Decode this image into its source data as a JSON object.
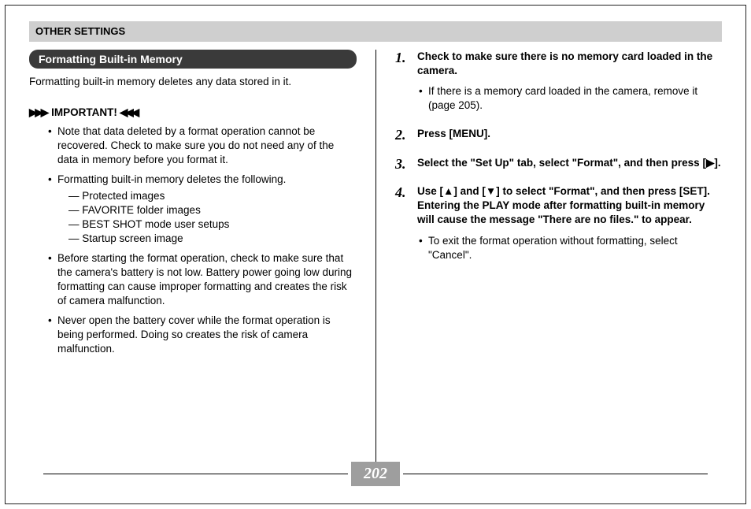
{
  "header": {
    "title": "OTHER SETTINGS"
  },
  "section": {
    "heading": "Formatting Built-in Memory",
    "intro": "Formatting built-in memory deletes any data stored in it.",
    "important_label": "IMPORTANT!",
    "arrows_left": "▶▶▶",
    "arrows_right": "▶▶▶",
    "bullets": {
      "b0": "Note that data deleted by a format operation cannot be recovered. Check to make sure you do not need any of the data in memory before you format it.",
      "b1": "Formatting built-in memory deletes the following.",
      "b1_items": {
        "d0": "Protected images",
        "d1": "FAVORITE folder images",
        "d2": "BEST SHOT mode user setups",
        "d3": "Startup screen image"
      },
      "b2": "Before starting the format operation, check to make sure that the camera's battery is not low. Battery power going low during formatting can cause improper formatting and creates the risk of camera malfunction.",
      "b3": "Never open the battery cover while the format operation is being performed. Doing so creates the risk of camera malfunction."
    }
  },
  "steps": {
    "s1_num": "1.",
    "s1": "Check to make sure there is no memory card loaded in the camera.",
    "s1_sub": "If there is a memory card loaded in the camera, remove it (page 205).",
    "s2_num": "2.",
    "s2": "Press [MENU].",
    "s3_num": "3.",
    "s3": "Select the \"Set Up\" tab, select \"Format\", and then press [▶].",
    "s4_num": "4.",
    "s4": "Use [▲] and [▼] to select \"Format\", and then press [SET]. Entering the PLAY mode after formatting built-in memory will cause the message \"There are no files.\" to appear.",
    "s4_sub": "To exit the format operation without formatting, select \"Cancel\"."
  },
  "page": {
    "number": "202"
  }
}
